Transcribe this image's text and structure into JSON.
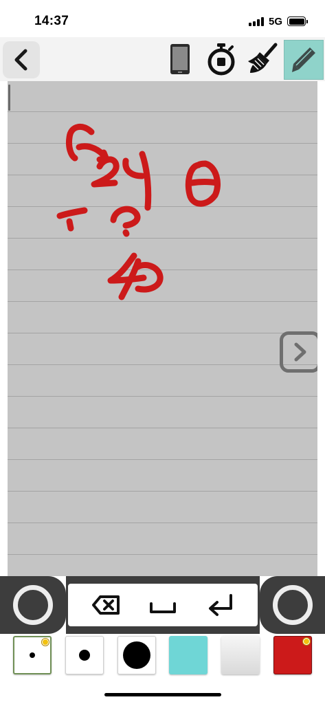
{
  "status_bar": {
    "time": "14:37",
    "network": "5G",
    "signal_bars": 4,
    "battery_level": 0.9
  },
  "toolbar": {
    "back": "chevron-left-icon",
    "buttons": [
      "phone-icon",
      "stopwatch-icon",
      "broom-icon",
      "pencil-icon"
    ],
    "active_tool": "pencil-icon",
    "active_color": "#8fd3ca"
  },
  "canvas": {
    "background": "#c4c4c4",
    "rule_color": "#a3a3a3",
    "ink_color": "#cc1a1a",
    "rule_count": 15,
    "next_page": "chevron-right-icon"
  },
  "keyboard": {
    "left_circle": "circle-icon",
    "keys": [
      "backspace-icon",
      "space-icon",
      "return-icon"
    ],
    "right_circle": "circle-icon"
  },
  "palette": {
    "pen_sizes": [
      "small",
      "medium",
      "large"
    ],
    "selected_size": "small",
    "colors": [
      "#6fd6d6",
      "#eeeeee",
      "#cc1a1a"
    ],
    "selected_color": "#cc1a1a",
    "settings_badge": "gear-icon"
  }
}
